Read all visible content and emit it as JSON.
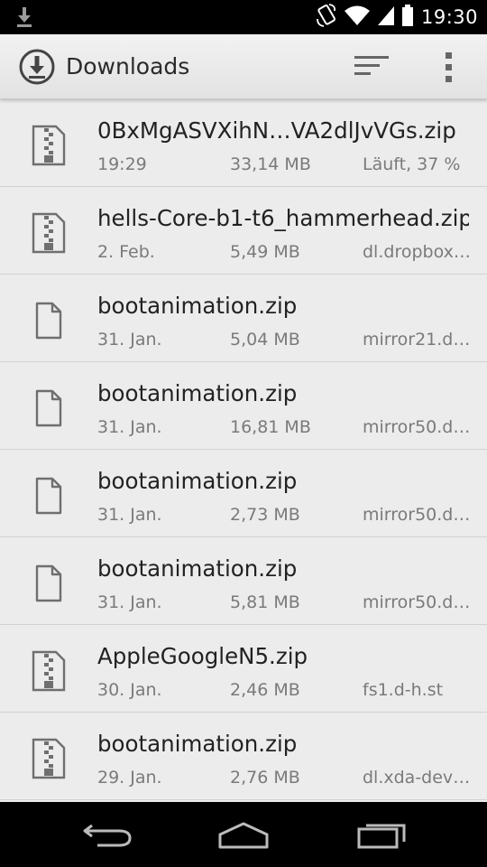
{
  "status_bar": {
    "time": "19:30",
    "icons": [
      "download-notification-icon",
      "rotation-icon",
      "wifi-icon",
      "signal-icon",
      "battery-icon"
    ]
  },
  "action_bar": {
    "title": "Downloads",
    "app_icon": "downloads-app-icon",
    "actions": [
      "sort-icon",
      "overflow-menu-icon"
    ]
  },
  "downloads": [
    {
      "icon": "zip-file-icon",
      "name": "0BxMgASVXihN…VA2dlJvVGs.zip",
      "date": "19:29",
      "size": "33,14 MB",
      "source": "Läuft, 37 %"
    },
    {
      "icon": "zip-file-icon",
      "name": "hells-Core-b1-t6_hammerhead.zip",
      "date": "2. Feb.",
      "size": "5,49 MB",
      "source": "dl.dropbox…"
    },
    {
      "icon": "file-icon",
      "name": "bootanimation.zip",
      "date": "31. Jan.",
      "size": "5,04 MB",
      "source": "mirror21.do…"
    },
    {
      "icon": "file-icon",
      "name": "bootanimation.zip",
      "date": "31. Jan.",
      "size": "16,81 MB",
      "source": "mirror50.do…"
    },
    {
      "icon": "file-icon",
      "name": "bootanimation.zip",
      "date": "31. Jan.",
      "size": "2,73 MB",
      "source": "mirror50.do…"
    },
    {
      "icon": "file-icon",
      "name": "bootanimation.zip",
      "date": "31. Jan.",
      "size": "5,81 MB",
      "source": "mirror50.do…"
    },
    {
      "icon": "zip-file-icon",
      "name": "AppleGoogleN5.zip",
      "date": "30. Jan.",
      "size": "2,46 MB",
      "source": "fs1.d-h.st"
    },
    {
      "icon": "zip-file-icon",
      "name": "bootanimation.zip",
      "date": "29. Jan.",
      "size": "2,76 MB",
      "source": "dl.xda-devel…"
    }
  ],
  "nav_bar": [
    "back-icon",
    "home-icon",
    "recent-apps-icon"
  ],
  "colors": {
    "status_bar_bg": "#000000",
    "action_bar_bg": "#ebebeb",
    "list_bg": "#ececec",
    "primary_text": "#222222",
    "secondary_text": "#7a7a7a",
    "divider": "#d2d2d2",
    "icon_gray": "#6f6f6f"
  }
}
